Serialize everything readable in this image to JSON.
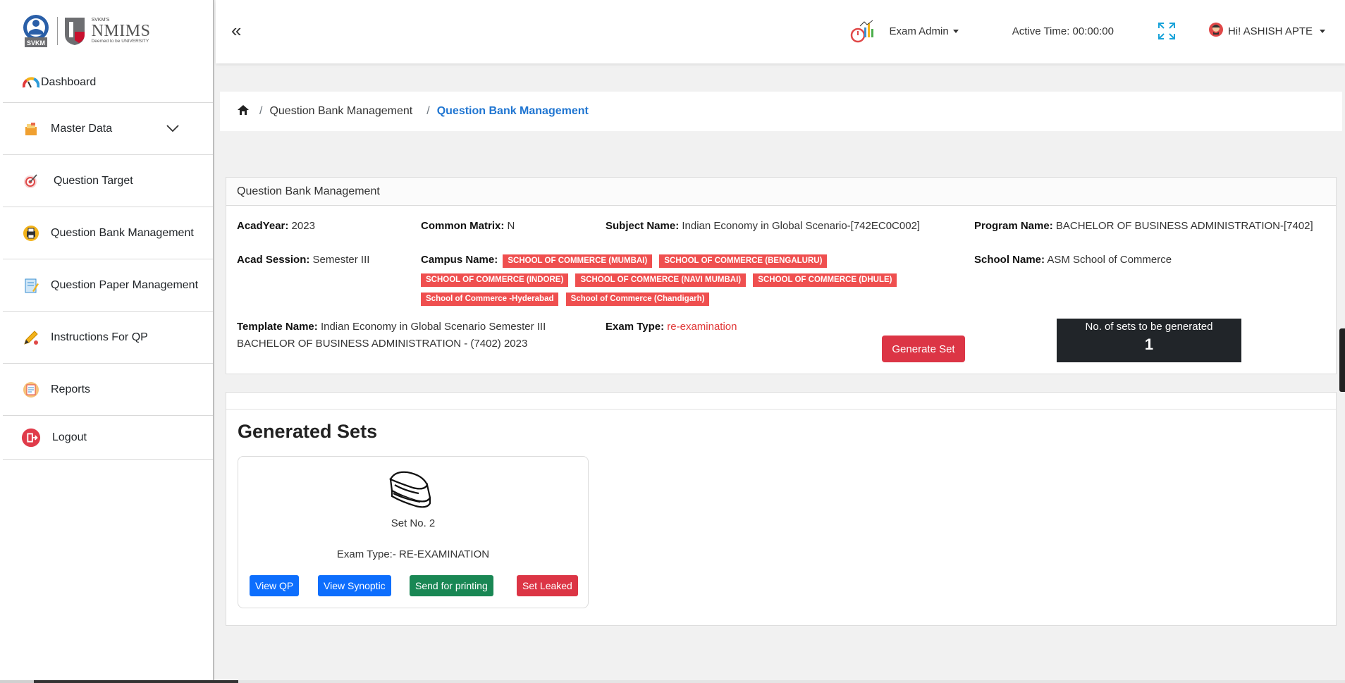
{
  "brand": {
    "logo_left": "SVKM",
    "logo_right_top": "SVKM'S",
    "logo_right": "NMIMS",
    "logo_right_sub": "Deemed to be UNIVERSITY"
  },
  "sidebar": {
    "items": [
      {
        "label": "Dashboard",
        "icon": "speedometer-icon"
      },
      {
        "label": "Master Data",
        "icon": "folder-icon"
      },
      {
        "label": "Question Target",
        "icon": "target-icon"
      },
      {
        "label": "Question Bank Management",
        "icon": "printer-icon"
      },
      {
        "label": "Question Paper Management",
        "icon": "notepad-icon"
      },
      {
        "label": "Instructions For QP",
        "icon": "pencil-icon"
      },
      {
        "label": "Reports",
        "icon": "report-icon"
      },
      {
        "label": "Logout",
        "icon": "logout-icon"
      }
    ]
  },
  "header": {
    "role": "Exam Admin",
    "active_time_label": "Active Time: 00:00:00",
    "user_greeting": "Hi! ASHISH APTE"
  },
  "breadcrumb": {
    "items": [
      "Question Bank Management",
      "Question Bank Management"
    ]
  },
  "info": {
    "title": "Question Bank Management",
    "acad_year_label": "AcadYear:",
    "acad_year": "2023",
    "common_matrix_label": "Common Matrix:",
    "common_matrix": "N",
    "subject_label": "Subject Name:",
    "subject": "Indian Economy in Global Scenario-[742EC0C002]",
    "program_label": "Program Name:",
    "program": "BACHELOR OF BUSINESS ADMINISTRATION-[7402]",
    "acad_session_label": "Acad Session:",
    "acad_session": "Semester III",
    "campus_label": "Campus Name:",
    "campuses": [
      "SCHOOL OF COMMERCE (MUMBAI)",
      "SCHOOL OF COMMERCE (BENGALURU)",
      "SCHOOL OF COMMERCE (INDORE)",
      "SCHOOL OF COMMERCE (NAVI MUMBAI)",
      "SCHOOL OF COMMERCE (DHULE)",
      "School of Commerce -Hyderabad",
      "School of Commerce (Chandigarh)"
    ],
    "school_label": "School Name:",
    "school": "ASM School of Commerce",
    "template_label": "Template Name:",
    "template_line1": "Indian Economy in Global Scenario Semester III",
    "template_line2": "BACHELOR OF BUSINESS ADMINISTRATION - (7402) 2023",
    "exam_type_label": "Exam Type:",
    "exam_type": "re-examination",
    "generate_button": "Generate Set",
    "sets_label": "No. of sets to be generated",
    "sets_count": "1"
  },
  "generated": {
    "title": "Generated Sets",
    "set_no": "Set No. 2",
    "exam_type": "Exam Type:- RE-EXAMINATION",
    "buttons": {
      "view_qp": "View QP",
      "view_synoptic": "View Synoptic",
      "send_printing": "Send for printing",
      "set_leaked": "Set Leaked"
    }
  },
  "colors": {
    "accent_blue": "#1f75d1",
    "danger": "#dc3545",
    "success": "#198754",
    "tag_red": "#ef4f4f",
    "dark": "#212529"
  }
}
